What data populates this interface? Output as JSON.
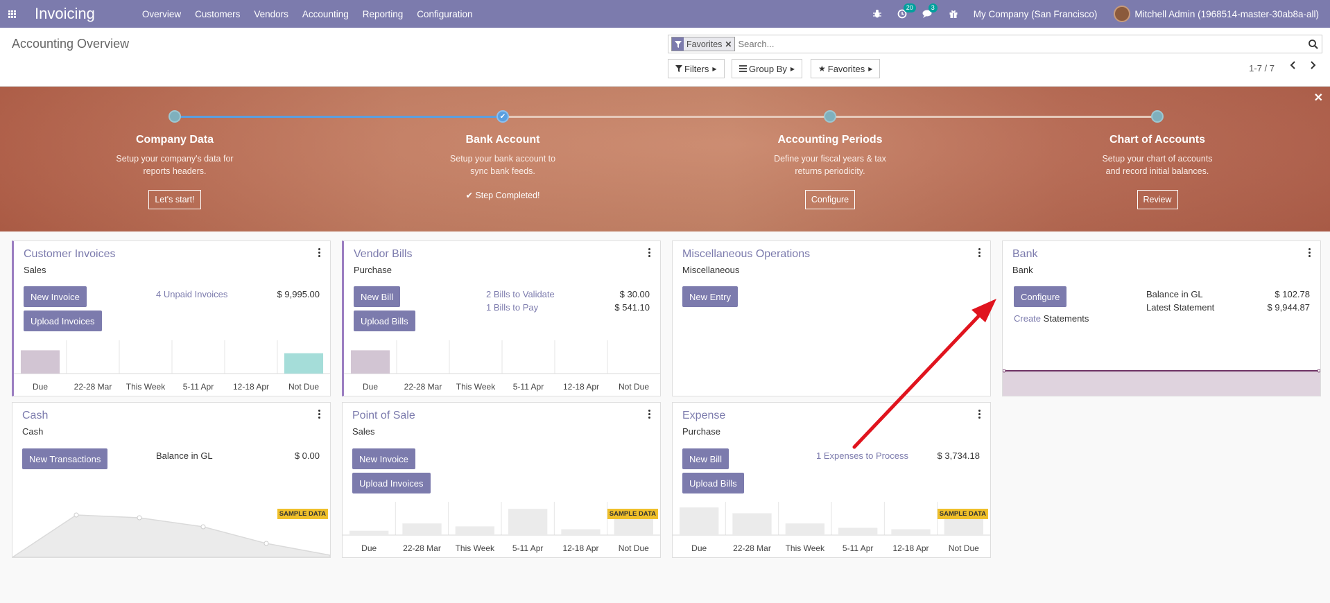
{
  "navbar": {
    "app_name": "Invoicing",
    "menu": [
      "Overview",
      "Customers",
      "Vendors",
      "Accounting",
      "Reporting",
      "Configuration"
    ],
    "activity_count": "20",
    "message_count": "3",
    "company": "My Company (San Francisco)",
    "user": "Mitchell Admin (1968514-master-30ab8a-all)"
  },
  "control": {
    "title": "Accounting Overview",
    "facet": "Favorites",
    "search_placeholder": "Search...",
    "filters": "Filters",
    "group_by": "Group By",
    "favorites": "Favorites",
    "pager": "1-7 / 7"
  },
  "onboarding": {
    "steps": [
      {
        "title": "Company Data",
        "desc": "Setup your company's data for reports headers.",
        "button": "Let's start!"
      },
      {
        "title": "Bank Account",
        "desc": "Setup your bank account to sync bank feeds.",
        "done": "Step Completed!"
      },
      {
        "title": "Accounting Periods",
        "desc": "Define your fiscal years & tax returns periodicity.",
        "button": "Configure"
      },
      {
        "title": "Chart of Accounts",
        "desc": "Setup your chart of accounts and record initial balances.",
        "button": "Review"
      }
    ]
  },
  "week_labels": [
    "Due",
    "22-28 Mar",
    "This Week",
    "5-11 Apr",
    "12-18 Apr",
    "Not Due"
  ],
  "cards": {
    "customer_invoices": {
      "title": "Customer Invoices",
      "sub": "Sales",
      "btn1": "New Invoice",
      "btn2": "Upload Invoices",
      "link": "4 Unpaid Invoices",
      "amount": "$ 9,995.00",
      "bars": [
        0.8,
        0,
        0,
        0,
        0,
        0.7
      ]
    },
    "vendor_bills": {
      "title": "Vendor Bills",
      "sub": "Purchase",
      "btn1": "New Bill",
      "btn2": "Upload Bills",
      "link1": "2 Bills to Validate",
      "amount1": "$ 30.00",
      "link2": "1 Bills to Pay",
      "amount2": "$ 541.10",
      "bars": [
        0.8,
        0,
        0,
        0,
        0,
        0
      ]
    },
    "misc": {
      "title": "Miscellaneous Operations",
      "sub": "Miscellaneous",
      "btn1": "New Entry"
    },
    "bank": {
      "title": "Bank",
      "sub": "Bank",
      "btn1": "Configure",
      "link": "Create",
      "link_suffix": "Statements",
      "label1": "Balance in GL",
      "amount1": "$ 102.78",
      "label2": "Latest Statement",
      "amount2": "$ 9,944.87"
    },
    "cash": {
      "title": "Cash",
      "sub": "Cash",
      "btn1": "New Transactions",
      "label": "Balance in GL",
      "amount": "$ 0.00",
      "sample": "SAMPLE DATA"
    },
    "pos": {
      "title": "Point of Sale",
      "sub": "Sales",
      "btn1": "New Invoice",
      "btn2": "Upload Invoices",
      "sample": "SAMPLE DATA",
      "bars": [
        0.15,
        0.4,
        0.3,
        0.9,
        0.2,
        0.55
      ]
    },
    "expense": {
      "title": "Expense",
      "sub": "Purchase",
      "btn1": "New Bill",
      "btn2": "Upload Bills",
      "link": "1 Expenses to Process",
      "amount": "$ 3,734.18",
      "sample": "SAMPLE DATA",
      "bars": [
        0.95,
        0.75,
        0.4,
        0.25,
        0.2,
        0.55
      ]
    }
  },
  "colors": {
    "brand": "#7c7bad",
    "annotation_arrow": "#e0141e"
  }
}
